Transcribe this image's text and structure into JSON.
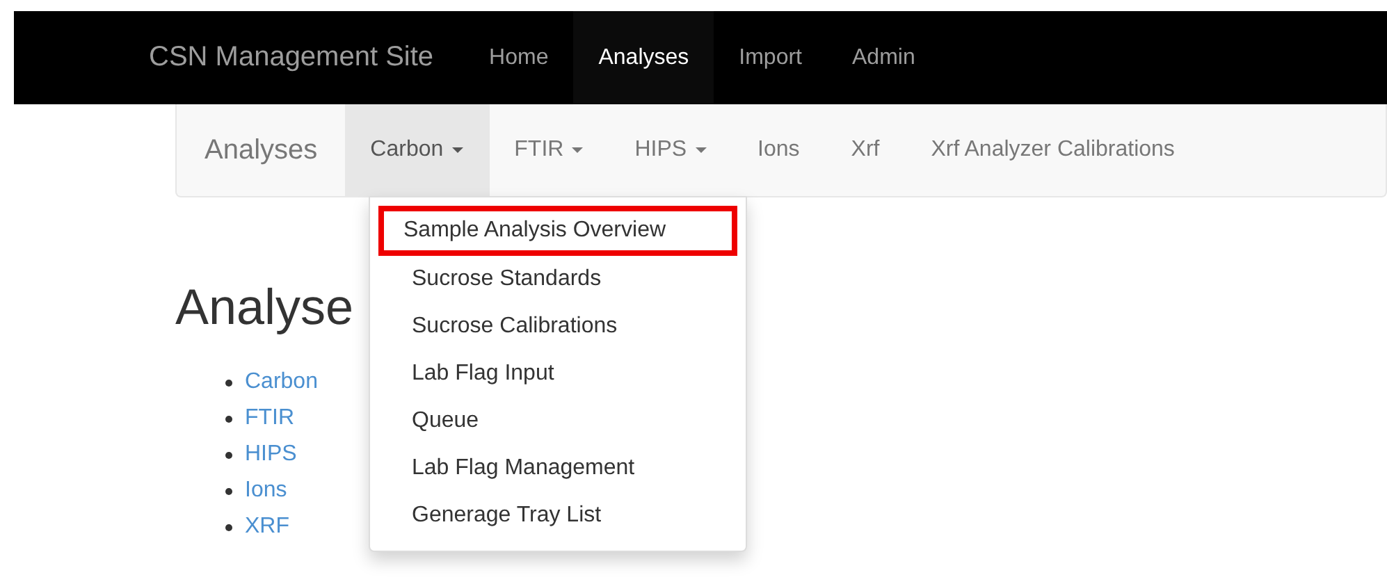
{
  "navbar": {
    "brand": "CSN Management Site",
    "items": [
      {
        "label": "Home",
        "selected": false
      },
      {
        "label": "Analyses",
        "selected": true
      },
      {
        "label": "Import",
        "selected": false
      },
      {
        "label": "Admin",
        "selected": false
      }
    ]
  },
  "subnav": {
    "brand": "Analyses",
    "items": [
      {
        "label": "Carbon",
        "dropdown": true,
        "selected": true
      },
      {
        "label": "FTIR",
        "dropdown": true,
        "selected": false
      },
      {
        "label": "HIPS",
        "dropdown": true,
        "selected": false
      },
      {
        "label": "Ions",
        "dropdown": false,
        "selected": false
      },
      {
        "label": "Xrf",
        "dropdown": false,
        "selected": false
      },
      {
        "label": "Xrf Analyzer Calibrations",
        "dropdown": false,
        "selected": false
      }
    ]
  },
  "dropdown_menu": {
    "items": [
      {
        "label": "Sample Analysis Overview",
        "highlighted": true
      },
      {
        "label": "Sucrose Standards",
        "highlighted": false
      },
      {
        "label": "Sucrose Calibrations",
        "highlighted": false
      },
      {
        "label": "Lab Flag Input",
        "highlighted": false
      },
      {
        "label": "Queue",
        "highlighted": false
      },
      {
        "label": "Lab Flag Management",
        "highlighted": false
      },
      {
        "label": "Generage Tray List",
        "highlighted": false
      }
    ]
  },
  "heading": "Analyse",
  "links": [
    "Carbon",
    "FTIR",
    "HIPS",
    "Ions",
    "XRF"
  ]
}
